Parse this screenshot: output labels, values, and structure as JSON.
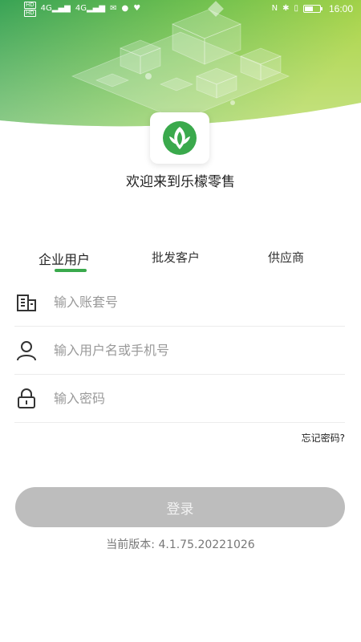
{
  "status_bar": {
    "time": "16:00",
    "battery_level": 0.55,
    "left_indicators": [
      "HD",
      "4G",
      "4G"
    ],
    "right_icons": [
      "nfc-icon",
      "bluetooth-icon",
      "vibrate-icon",
      "battery-icon"
    ]
  },
  "brand": {
    "welcome_text": "欢迎来到乐檬零售",
    "colors": {
      "primary": "#3aa94c",
      "banner_start": "#2e9e4c",
      "banner_end": "#a6d23d"
    }
  },
  "tabs": [
    {
      "label": "企业用户",
      "active": true
    },
    {
      "label": "批发客户",
      "active": false
    },
    {
      "label": "供应商",
      "active": false
    }
  ],
  "form": {
    "account_set": {
      "placeholder": "输入账套号",
      "value": "",
      "icon": "building-icon"
    },
    "username": {
      "placeholder": "输入用户名或手机号",
      "value": "",
      "icon": "user-icon"
    },
    "password": {
      "placeholder": "输入密码",
      "value": "",
      "icon": "lock-icon"
    }
  },
  "forgot_password_label": "忘记密码?",
  "login_label": "登录",
  "version_text": "当前版本: 4.1.75.20221026"
}
